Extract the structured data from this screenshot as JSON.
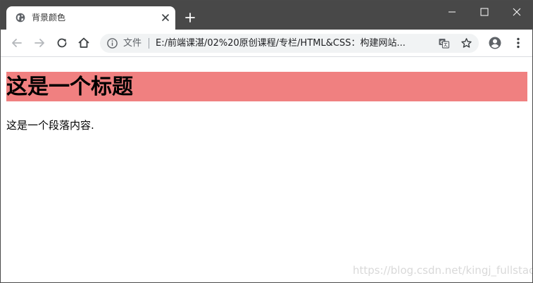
{
  "browser": {
    "tab": {
      "title": "背景颜色",
      "favicon_icon": "globe-icon",
      "close_icon": "close-icon"
    },
    "new_tab_icon": "plus-icon",
    "window_controls": [
      "minimize-icon",
      "maximize-icon",
      "close-icon"
    ],
    "toolbar": {
      "back_icon": "arrow-left-icon",
      "forward_icon": "arrow-right-icon",
      "reload_icon": "reload-icon",
      "home_icon": "home-icon",
      "omnibox": {
        "info_icon": "info-icon",
        "scheme_label": "文件",
        "url": "E:/前端课湛/02%20原创课程/专栏/HTML&CSS：构建网站...",
        "translate_icon": "translate-icon",
        "bookmark_icon": "star-icon"
      },
      "profile_icon": "account-icon",
      "menu_icon": "more-vert-icon"
    }
  },
  "page": {
    "heading": "这是一个标题",
    "heading_background": "#f08080",
    "paragraph": "这是一个段落内容."
  },
  "watermark": "https://blog.csdn.net/kingj_fullstack",
  "colors": {
    "titlebar": "#484848",
    "heading_bg": "#f08080"
  }
}
